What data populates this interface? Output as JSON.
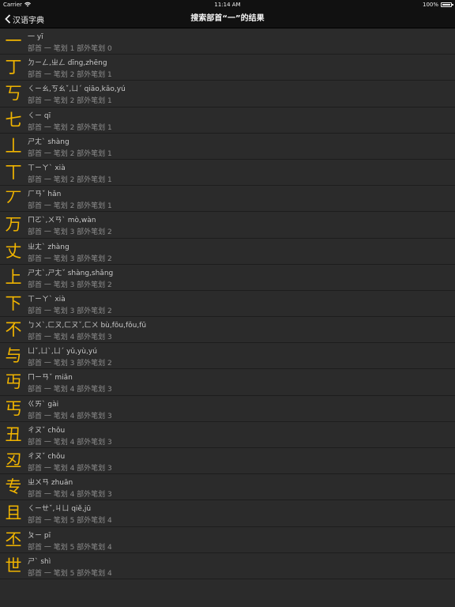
{
  "status_bar": {
    "carrier": "Carrier",
    "time": "11:14 AM",
    "battery": "100%"
  },
  "nav": {
    "back_label": "汉语字典",
    "title": "搜索部首“一”的结果"
  },
  "rows": [
    {
      "char": "一",
      "pron": "一  yī",
      "meta": "部首 一  笔划 1  部外笔划 0"
    },
    {
      "char": "丁",
      "pron": "ㄉㄧㄥ,ㄓㄥ  dīng,zhēng",
      "meta": "部首 一  笔划 2  部外笔划 1"
    },
    {
      "char": "丂",
      "pron": "ㄑㄧㄠ,ㄎㄠˇ,ㄩˊ  qiāo,kǎo,yú",
      "meta": "部首 一  笔划 2  部外笔划 1"
    },
    {
      "char": "七",
      "pron": "ㄑㄧ  qī",
      "meta": "部首 一  笔划 2  部外笔划 1"
    },
    {
      "char": "丄",
      "pron": "ㄕㄤˋ  shàng",
      "meta": "部首 一  笔划 2  部外笔划 1"
    },
    {
      "char": "丅",
      "pron": "ㄒㄧㄚˋ  xià",
      "meta": "部首 一  笔划 2  部外笔划 1"
    },
    {
      "char": "丆",
      "pron": "ㄏㄢˇ  hǎn",
      "meta": "部首 一  笔划 2  部外笔划 1"
    },
    {
      "char": "万",
      "pron": "ㄇㄛˋ,ㄨㄢˋ  mò,wàn",
      "meta": "部首 一  笔划 3  部外笔划 2"
    },
    {
      "char": "丈",
      "pron": "ㄓㄤˋ  zhàng",
      "meta": "部首 一  笔划 3  部外笔划 2"
    },
    {
      "char": "上",
      "pron": "ㄕㄤˋ,ㄕㄤˇ  shàng,shǎng",
      "meta": "部首 一  笔划 3  部外笔划 2"
    },
    {
      "char": "下",
      "pron": "ㄒㄧㄚˋ  xià",
      "meta": "部首 一  笔划 3  部外笔划 2"
    },
    {
      "char": "不",
      "pron": "ㄅㄨˋ,ㄈㄡ,ㄈㄡˇ,ㄈㄨ  bù,fōu,fǒu,fū",
      "meta": "部首 一  笔划 4  部外笔划 3"
    },
    {
      "char": "与",
      "pron": "ㄩˇ,ㄩˋ,ㄩˊ  yǔ,yù,yú",
      "meta": "部首 一  笔划 3  部外笔划 2"
    },
    {
      "char": "丏",
      "pron": "ㄇㄧㄢˇ  miǎn",
      "meta": "部首 一  笔划 4  部外笔划 3"
    },
    {
      "char": "丐",
      "pron": "ㄍㄞˋ  gài",
      "meta": "部首 一  笔划 4  部外笔划 3"
    },
    {
      "char": "丑",
      "pron": "ㄔㄡˇ  chǒu",
      "meta": "部首 一  笔划 4  部外笔划 3"
    },
    {
      "char": "丒",
      "pron": "ㄔㄡˇ  chǒu",
      "meta": "部首 一  笔划 4  部外笔划 3"
    },
    {
      "char": "专",
      "pron": "ㄓㄨㄢ  zhuān",
      "meta": "部首 一  笔划 4  部外笔划 3"
    },
    {
      "char": "且",
      "pron": "ㄑㄧㄝˇ,ㄐㄩ  qiě,jū",
      "meta": "部首 一  笔划 5  部外笔划 4"
    },
    {
      "char": "丕",
      "pron": "ㄆㄧ  pī",
      "meta": "部首 一  笔划 5  部外笔划 4"
    },
    {
      "char": "世",
      "pron": "ㄕˋ  shì",
      "meta": "部首 一  笔划 5  部外笔划 4"
    }
  ]
}
